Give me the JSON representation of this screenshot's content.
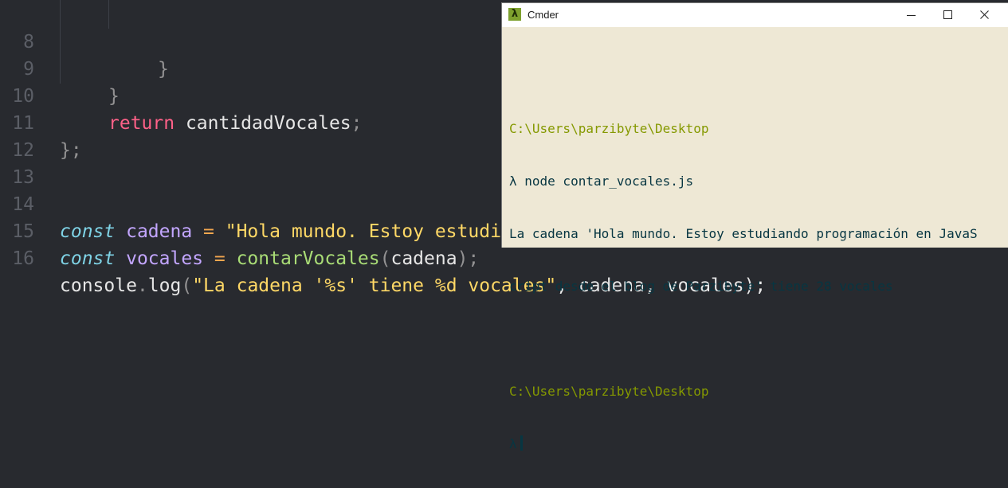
{
  "editor": {
    "lines": [
      {
        "num": "8",
        "code": "}"
      },
      {
        "num": "9",
        "code": "}"
      },
      {
        "num": "10",
        "kw": "return",
        "code": " cantidadVocales",
        "semi": ";"
      },
      {
        "num": "11",
        "code": "};"
      },
      {
        "num": "12",
        "code": ""
      },
      {
        "num": "13",
        "code": ""
      },
      {
        "num": "14",
        "const": "const",
        "name": " cadena",
        "eq": " =",
        "str": " \"Hola mundo. Estoy estudiando programación en JavaScript desde e"
      },
      {
        "num": "15",
        "const": "const",
        "name": " vocales",
        "eq": " =",
        "fn": " contarVocales",
        "p1": "(",
        "arg": "cadena",
        "p2": ");"
      },
      {
        "num": "16",
        "obj": "console",
        "dot": ".",
        "fn": "log",
        "p1": "(",
        "str": "\"La cadena '%s' tiene %d vocales\"",
        "rest": ", cadena, vocales);"
      }
    ]
  },
  "terminal": {
    "title": "Cmder",
    "icon_glyph": "λ",
    "lines": [
      {
        "type": "path",
        "text": "C:\\Users\\parzibyte\\Desktop"
      },
      {
        "type": "out",
        "text": "λ node contar_vocales.js"
      },
      {
        "type": "out",
        "text": "La cadena 'Hola mundo. Estoy estudiando programación en JavaS"
      },
      {
        "type": "out",
        "text": "cript desde el blog de Parzibyte' tiene 28 vocales"
      },
      {
        "type": "blank",
        "text": ""
      },
      {
        "type": "path",
        "text": "C:\\Users\\parzibyte\\Desktop"
      },
      {
        "type": "prompt",
        "text": "λ"
      }
    ]
  },
  "colors": {
    "editor_bg": "#282a2f",
    "terminal_bg": "#eee8d5",
    "path": "#859900",
    "output": "#073642"
  }
}
